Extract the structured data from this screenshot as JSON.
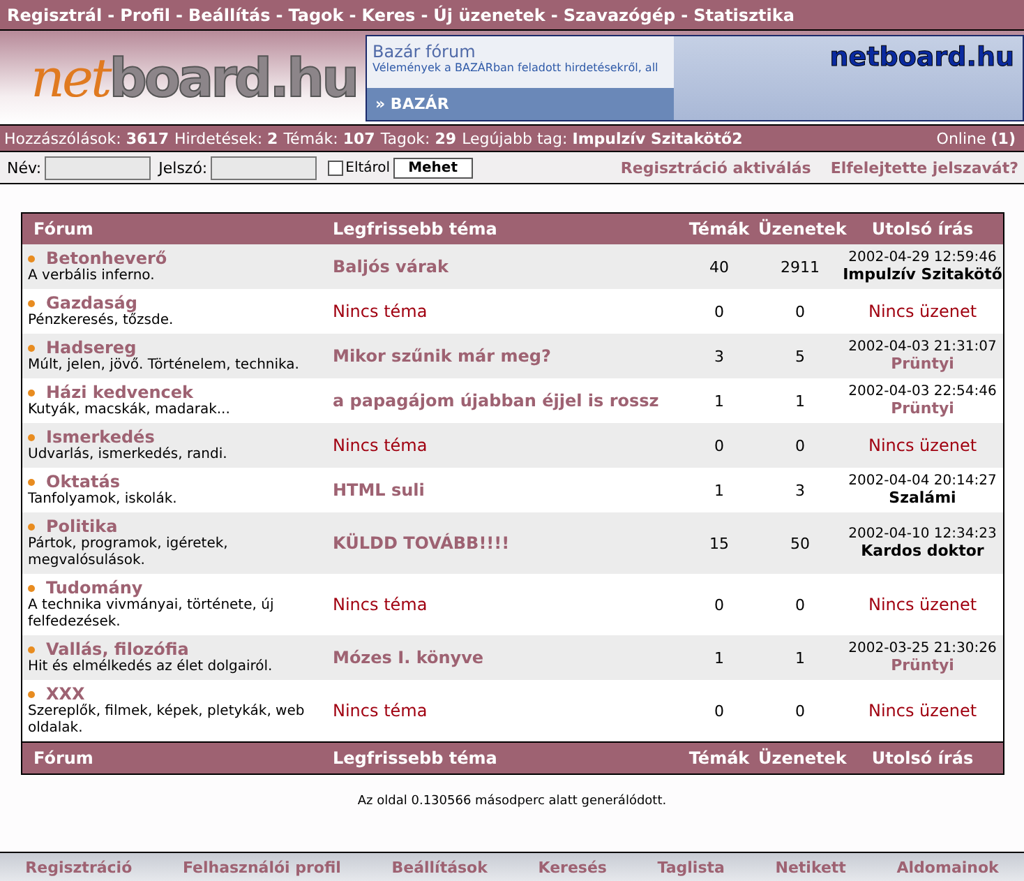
{
  "top_nav_separator": "-",
  "top_nav": [
    "Regisztrál",
    "Profil",
    "Beállítás",
    "Tagok",
    "Keres",
    "Új üzenetek",
    "Szavazógép",
    "Statisztika"
  ],
  "logo": {
    "part_1": "net",
    "part_2": "board.hu"
  },
  "banner": {
    "title": "Bazár fórum",
    "subtitle": "Vélemények a BAZÁRban feladott hirdetésekről, all",
    "link": "» BAZÁR",
    "brand": "netboard.hu"
  },
  "stats": [
    {
      "label": "Hozzászólások:",
      "value": "3617"
    },
    {
      "label": "Hirdetések:",
      "value": "2"
    },
    {
      "label": "Témák:",
      "value": "107"
    },
    {
      "label": "Tagok:",
      "value": "29"
    },
    {
      "label": "Legújabb tag:",
      "value": "Impulzív Szitakötő2"
    }
  ],
  "online": {
    "label": "Online",
    "value": "(1)"
  },
  "login": {
    "name_label": "Név:",
    "password_label": "Jelszó:",
    "remember_label": "Eltárol",
    "remember_checked": false,
    "button": "Mehet",
    "links": [
      "Regisztráció aktiválás",
      "Elfelejtette jelszavát?"
    ]
  },
  "table": {
    "columns": [
      "Fórum",
      "Legfrissebb téma",
      "Témák",
      "Üzenetek",
      "Utolsó írás"
    ],
    "rows": [
      {
        "forum": "Betonheverő",
        "description": "A verbális inferno.",
        "topic": {
          "kind": "topic",
          "text": "Baljós várak"
        },
        "topics": "40",
        "posts": "2911",
        "last": {
          "kind": "post",
          "date": "2002-04-29 12:59:46",
          "author": "Impulzív Szitakötő",
          "linked": false
        }
      },
      {
        "forum": "Gazdaság",
        "description": "Pénzkeresés, tőzsde.",
        "topic": {
          "kind": "none",
          "text": "Nincs téma"
        },
        "topics": "0",
        "posts": "0",
        "last": {
          "kind": "none",
          "text": "Nincs üzenet"
        }
      },
      {
        "forum": "Hadsereg",
        "description": "Múlt, jelen, jövő. Történelem, technika.",
        "topic": {
          "kind": "topic",
          "text": "Mikor szűnik már meg?"
        },
        "topics": "3",
        "posts": "5",
        "last": {
          "kind": "post",
          "date": "2002-04-03 21:31:07",
          "author": "Prüntyi",
          "linked": true
        }
      },
      {
        "forum": "Házi kedvencek",
        "description": "Kutyák, macskák, madarak...",
        "topic": {
          "kind": "topic",
          "text": "a papagájom újabban éjjel is rossz"
        },
        "topics": "1",
        "posts": "1",
        "last": {
          "kind": "post",
          "date": "2002-04-03 22:54:46",
          "author": "Prüntyi",
          "linked": true
        }
      },
      {
        "forum": "Ismerkedés",
        "description": "Udvarlás, ismerkedés, randi.",
        "topic": {
          "kind": "none",
          "text": "Nincs téma"
        },
        "topics": "0",
        "posts": "0",
        "last": {
          "kind": "none",
          "text": "Nincs üzenet"
        }
      },
      {
        "forum": "Oktatás",
        "description": "Tanfolyamok, iskolák.",
        "topic": {
          "kind": "topic",
          "text": "HTML suli"
        },
        "topics": "1",
        "posts": "3",
        "last": {
          "kind": "post",
          "date": "2002-04-04 20:14:27",
          "author": "Szalámi",
          "linked": false
        }
      },
      {
        "forum": "Politika",
        "description": "Pártok, programok, igéretek, megvalósulások.",
        "topic": {
          "kind": "topic",
          "text": "KÜLDD TOVÁBB!!!!"
        },
        "topics": "15",
        "posts": "50",
        "last": {
          "kind": "post",
          "date": "2002-04-10 12:34:23",
          "author": "Kardos doktor",
          "linked": false
        }
      },
      {
        "forum": "Tudomány",
        "description": "A technika vivmányai, története, új felfedezések.",
        "topic": {
          "kind": "none",
          "text": "Nincs téma"
        },
        "topics": "0",
        "posts": "0",
        "last": {
          "kind": "none",
          "text": "Nincs üzenet"
        }
      },
      {
        "forum": "Vallás, filozófia",
        "description": "Hit és elmélkedés az élet dolgairól.",
        "topic": {
          "kind": "topic",
          "text": "Mózes I. könyve"
        },
        "topics": "1",
        "posts": "1",
        "last": {
          "kind": "post",
          "date": "2002-03-25 21:30:26",
          "author": "Prüntyi",
          "linked": true
        }
      },
      {
        "forum": "XXX",
        "description": "Szereplők, filmek, képek, pletykák, web oldalak.",
        "topic": {
          "kind": "none",
          "text": "Nincs téma"
        },
        "topics": "0",
        "posts": "0",
        "last": {
          "kind": "none",
          "text": "Nincs üzenet"
        }
      }
    ],
    "footer_columns": [
      "Fórum",
      "Legfrissebb téma",
      "Témák",
      "Üzenetek",
      "Utolsó írás"
    ]
  },
  "generated": "Az oldal 0.130566 másodperc alatt generálódott.",
  "bottom_nav": [
    "Regisztráció",
    "Felhasználói profil",
    "Beállítások",
    "Keresés",
    "Taglista",
    "Netikett",
    "Aldomainok"
  ]
}
